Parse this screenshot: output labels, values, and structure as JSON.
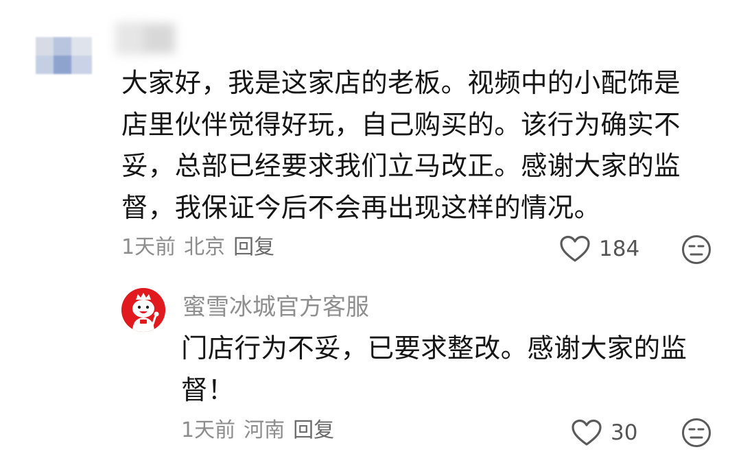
{
  "comment": {
    "lines": [
      "大家好，我是这家店的老板。视频中的小配饰是",
      "店里伙伴觉得好玩，自己购买的。该行为确实不",
      "妥，总部已经要求我们立马改正。感谢大家的监",
      "督，我保证今后不会再出现这样的情况。"
    ],
    "time": "1天前",
    "location": "北京",
    "reply_label": "回复",
    "like_count": "184"
  },
  "reply": {
    "username": "蜜雪冰城官方客服",
    "lines": [
      "门店行为不妥，已要求整改。感谢大家的监",
      "督！"
    ],
    "time": "1天前",
    "location": "河南",
    "reply_label": "回复",
    "like_count": "30"
  },
  "icons": {
    "like": "heart-outline-icon",
    "dislike": "neutral-face-icon",
    "avatar": "snow-king-mascot-avatar"
  },
  "colors": {
    "text": "#161616",
    "meta": "#8d8d8d",
    "username": "#8f8f8f",
    "brand_red": "#e01a1f"
  }
}
